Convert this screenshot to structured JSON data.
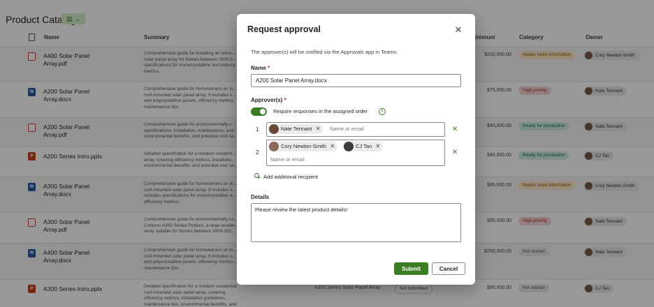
{
  "page": {
    "title": "Product Catalog",
    "columns": {
      "name": "Name",
      "summary": "Summary",
      "minimum": "inimum",
      "category": "Category",
      "owner": "Owner"
    },
    "rows": [
      {
        "name": "A400 Solar Panel Array.pdf",
        "type": "pdf",
        "summary": "Comprehensive guide for installing an extra-... solar panel array for homes between 3500-5... specifications for monocrystalline and polycry... metrics.",
        "price": "$250,000.00",
        "category": "Needs more information",
        "category_style": "needs",
        "owner": "Cory Newton-Smith"
      },
      {
        "name": "A200 Solar Panel Array.docx",
        "type": "docx",
        "summary": "Comprehensive guide for homeowners on in... roof-mounted solar panel array. It includes s... and polycrystalline panels, efficiency metrics, maintenance tips.",
        "price": "$75,000.00",
        "category": "High priority",
        "category_style": "high",
        "owner": "Nate Tennant"
      },
      {
        "name": "A200 Solar Panel Array.pdf",
        "type": "pdf",
        "summary": "Comprehensive guide for environmentally-c... specifications, installation, maintenance, and... environmental benefits, and potential cost sa...",
        "price": "$40,000.00",
        "category": "Ready for production",
        "category_style": "ready",
        "owner": "Nate Tennant"
      },
      {
        "name": "A200 Series Intro.pptx",
        "type": "pptx",
        "summary": "Detailed specification for a medium resident... array, covering efficiency metrics, installatio... environmental benefits, and potential cost sa...",
        "price": "$40,000.00",
        "category": "Ready for production",
        "category_style": "ready",
        "owner": "CJ Tan"
      },
      {
        "name": "A300 Solar Panel Array.docx",
        "type": "docx",
        "summary": "Comprehensive guide for homeowners on in... roof-mounted solar panel array. It includes s... includes specifications for monocrystalline a... efficiency metrics.",
        "price": "$95,000.00",
        "category": "Needs more information",
        "category_style": "needs",
        "owner": "Cory Newton-Smith"
      },
      {
        "name": "A300 Solar Panel Array.pdf",
        "type": "pdf",
        "summary": "Comprehensive guide for environmentally-co... Contoso A300 Series Product, a large resider... array suitable for homes between 2800-350...",
        "price": "$95,000.00",
        "category": "High priority",
        "category_style": "high",
        "owner": "Nate Tennant"
      },
      {
        "name": "A400 Solar Panel Array.docx",
        "type": "docx",
        "summary": "Comprehensive guide for homeowners on in... roof-mounted solar panel array. It includes s... and polycrystalline panels, efficiency metrics... maintenance tips.",
        "price": "$250,000.00",
        "category": "Not started",
        "category_style": "not",
        "owner": "Nate Tennant"
      },
      {
        "name": "A300 Series Intro.pptx",
        "type": "pptx",
        "summary": "Detailed specification for a medium residential roof-mounted solar panel array, covering efficiency metrics, installation guidelines, maintenance tips, environmental benefits, and potential cost savings over time.",
        "price": "$90,000.00",
        "category": "Not started",
        "category_style": "not",
        "owner": "CJ Tan",
        "related": "A300 Series Solar Panel Array",
        "status": "Not submitted"
      }
    ]
  },
  "dialog": {
    "title": "Request approval",
    "description": "The approver(s) will be notified via the Approvals app in Teams.",
    "name_label": "Name",
    "required_mark": "*",
    "name_value": "A200 Solar Panel Array.docx",
    "approvers_label": "Approver(s)",
    "toggle_label": "Require responses in the assigned order",
    "toggle_on": true,
    "approver_groups": [
      {
        "order": "1",
        "people": [
          "Nate Tennant"
        ],
        "placeholder": "Name or email"
      },
      {
        "order": "2",
        "people": [
          "Cory Newton-Smith",
          "CJ Tan"
        ],
        "placeholder": "Name or email"
      }
    ],
    "add_recipient": "Add additional recipient",
    "details_label": "Details",
    "details_value": "Please review the latest product details!",
    "submit": "Submit",
    "cancel": "Cancel"
  }
}
